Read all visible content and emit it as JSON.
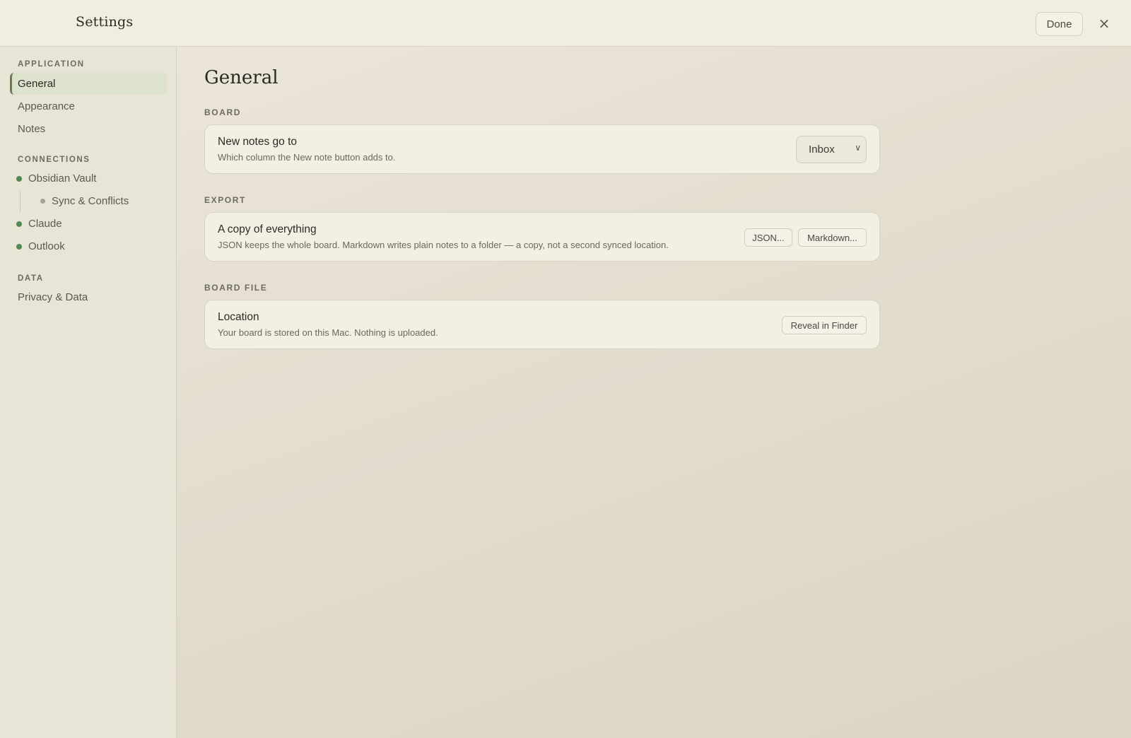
{
  "window": {
    "title": "Settings",
    "done_label": "Done",
    "close_icon": "×"
  },
  "sidebar": {
    "sections": [
      {
        "heading": "APPLICATION"
      },
      {
        "heading": "CONNECTIONS"
      },
      {
        "heading": "DATA"
      }
    ],
    "items": {
      "general": "General",
      "appearance": "Appearance",
      "notes": "Notes",
      "obsidian": "Obsidian Vault",
      "sync": "Sync & Conflicts",
      "claude": "Claude",
      "outlook": "Outlook",
      "privacy": "Privacy & Data"
    },
    "active": "General",
    "status_colors": {
      "connected": "#4f8a4e",
      "sub": "#a7a398"
    }
  },
  "main": {
    "title": "General",
    "sections": {
      "board": {
        "label": "BOARD",
        "title": "New notes go to",
        "description": "Which column the New note button adds to.",
        "select_value": "Inbox",
        "select_icon": "chevron-down-icon"
      },
      "export": {
        "label": "EXPORT",
        "title": "A copy of everything",
        "description": "JSON keeps the whole board. Markdown writes plain notes to a folder — a copy, not a second synced location.",
        "json_label": "JSON...",
        "markdown_label": "Markdown..."
      },
      "board_file": {
        "label": "BOARD FILE",
        "title": "Location",
        "description": "Your board is stored on this Mac. Nothing is uploaded.",
        "reveal_label": "Reveal in Finder"
      }
    }
  },
  "colors": {
    "accent": "#6b7a55",
    "background": "#e2dccd",
    "card": "#f2efe3"
  }
}
